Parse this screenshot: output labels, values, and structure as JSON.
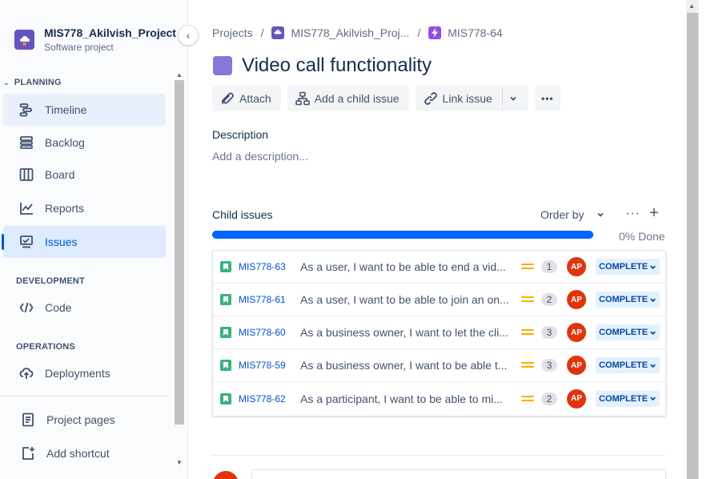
{
  "sidebar": {
    "project_name": "MIS778_Akilvish_Project",
    "project_type": "Software project",
    "collapse_icon": "‹",
    "sections": {
      "planning": "PLANNING",
      "development": "DEVELOPMENT",
      "operations": "OPERATIONS"
    },
    "items": [
      {
        "label": "Timeline",
        "icon": "timeline-icon"
      },
      {
        "label": "Backlog",
        "icon": "backlog-icon"
      },
      {
        "label": "Board",
        "icon": "board-icon"
      },
      {
        "label": "Reports",
        "icon": "reports-icon"
      },
      {
        "label": "Issues",
        "icon": "issues-icon"
      },
      {
        "label": "Code",
        "icon": "code-icon"
      },
      {
        "label": "Deployments",
        "icon": "deployments-icon"
      },
      {
        "label": "Project pages",
        "icon": "pages-icon"
      },
      {
        "label": "Add shortcut",
        "icon": "add-shortcut-icon"
      }
    ]
  },
  "breadcrumb": {
    "projects": "Projects",
    "sep": "/",
    "project": "MIS778_Akilvish_Proj...",
    "issue_key": "MIS778-64"
  },
  "issue": {
    "title": "Video call functionality",
    "toolbar": {
      "attach": "Attach",
      "add_child": "Add a child issue",
      "link_issue": "Link issue",
      "more": "•••"
    },
    "description_label": "Description",
    "description_placeholder": "Add a description..."
  },
  "child_issues": {
    "title": "Child issues",
    "order_by": "Order by",
    "more": "···",
    "add": "+",
    "progress_label": "0% Done",
    "progress_percent": 0,
    "rows": [
      {
        "key": "MIS778-63",
        "summary": "As a user, I want to be able to end a vid...",
        "points": "1",
        "assignee": "AP",
        "status": "COMPLETE"
      },
      {
        "key": "MIS778-61",
        "summary": "As a user, I want to be able to join an on...",
        "points": "2",
        "assignee": "AP",
        "status": "COMPLETE"
      },
      {
        "key": "MIS778-60",
        "summary": "As a business owner, I want to let the cli...",
        "points": "3",
        "assignee": "AP",
        "status": "COMPLETE"
      },
      {
        "key": "MIS778-59",
        "summary": "As a business owner, I want to be able t...",
        "points": "3",
        "assignee": "AP",
        "status": "COMPLETE"
      },
      {
        "key": "MIS778-62",
        "summary": "As a participant, I want to be able to mi...",
        "points": "2",
        "assignee": "AP",
        "status": "COMPLETE"
      }
    ]
  },
  "colors": {
    "accent": "#0052cc",
    "progress": "#0065ff",
    "epic": "#8777d9",
    "story": "#36b37e",
    "priority_medium": "#ffab00",
    "avatar": "#de350b"
  }
}
